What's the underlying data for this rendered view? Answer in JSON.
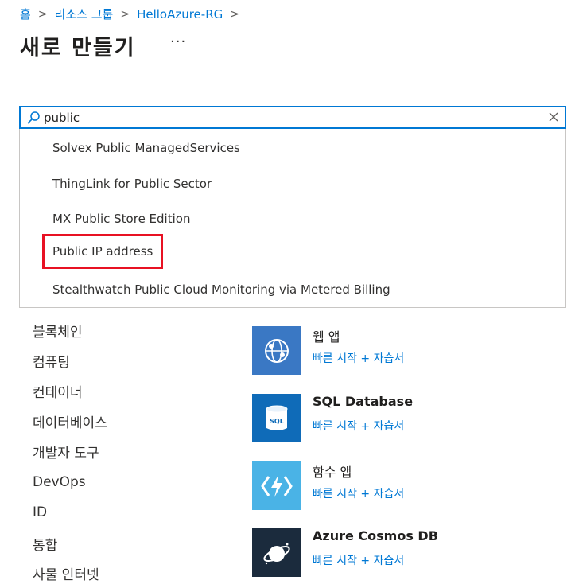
{
  "breadcrumb": {
    "items": [
      "홈",
      "리소스 그룹",
      "HelloAzure-RG"
    ],
    "separator": ">"
  },
  "page": {
    "title": "새로 만들기",
    "more_label": "···"
  },
  "search": {
    "value": "public",
    "icon": "search-icon",
    "clear_icon": "close-icon"
  },
  "suggestions": [
    "Solvex Public ManagedServices",
    "ThingLink for Public Sector",
    "MX Public Store Edition",
    "Public IP address",
    "Stealthwatch Public Cloud Monitoring via Metered Billing"
  ],
  "highlighted_suggestion": "Public IP address",
  "categories": [
    "블록체인",
    "컴퓨팅",
    "컨테이너",
    "데이터베이스",
    "개발자 도구",
    "DevOps",
    "ID",
    "통합",
    "사물 인터넷"
  ],
  "services": [
    {
      "name": "웹 앱",
      "link": "빠른 시작 + 자습서",
      "icon": "web-app-icon",
      "color": "#3a78c4"
    },
    {
      "name": "SQL Database",
      "link": "빠른 시작 + 자습서",
      "icon": "sql-database-icon",
      "color": "#0f6bb8"
    },
    {
      "name": "함수 앱",
      "link": "빠른 시작 + 자습서",
      "icon": "function-app-icon",
      "color": "#4ab3e6"
    },
    {
      "name": "Azure Cosmos DB",
      "link": "빠른 시작 + 자습서",
      "icon": "cosmos-db-icon",
      "color": "#1b2b3d"
    }
  ],
  "colors": {
    "accent": "#0078d4",
    "highlight_border": "#e81123"
  }
}
